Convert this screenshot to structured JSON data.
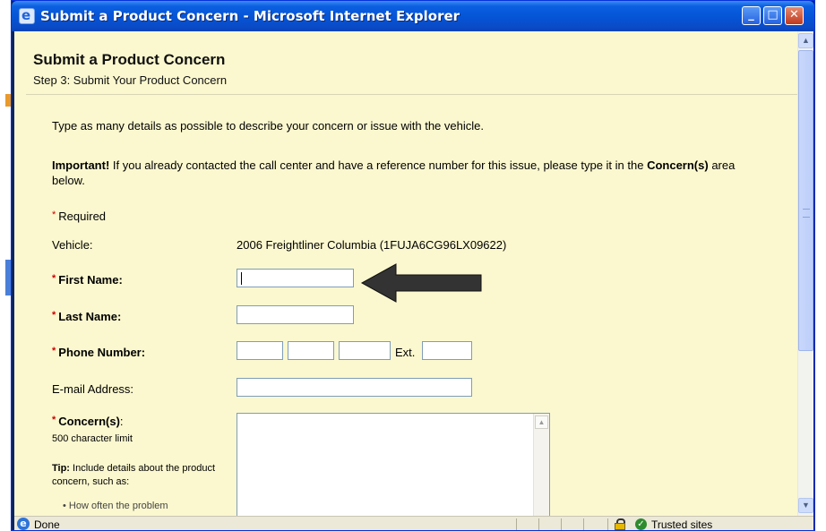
{
  "window": {
    "title": "Submit a Product Concern - Microsoft Internet Explorer",
    "min_glyph": "_",
    "max_glyph": "□",
    "close_glyph": "✕"
  },
  "page": {
    "title": "Submit a Product Concern",
    "subtitle": "Step 3: Submit Your Product Concern",
    "intro": "Type as many details as possible to describe your concern or issue with the vehicle.",
    "important": {
      "lead": "Important!",
      "text1": " If you already contacted the call center and have a reference number for this issue, please type it in the ",
      "emph": "Concern(s)",
      "text2": " area below."
    },
    "required_marker": "*",
    "required_note": "Required"
  },
  "form": {
    "vehicle_label": "Vehicle:",
    "vehicle_value": "2006 Freightliner Columbia (1FUJA6CG96LX09622)",
    "first_name_label": "First Name:",
    "first_name_value": "",
    "last_name_label": "Last Name:",
    "last_name_value": "",
    "phone_label": "Phone Number:",
    "phone_area": "",
    "phone_prefix": "",
    "phone_line": "",
    "ext_label": "Ext.",
    "phone_ext": "",
    "email_label": "E-mail Address:",
    "email_value": "",
    "concern_label": "Concern(s)",
    "concern_colon": ":",
    "concern_note": "500 character limit",
    "concern_value": "",
    "tip_lead": "Tip:",
    "tip_text": " Include details about the product concern, such as:",
    "tip_bullet": "•    How often the problem"
  },
  "statusbar": {
    "status": "Done",
    "zone": "Trusted sites",
    "ie_glyph": "e",
    "check_glyph": "✓"
  },
  "colors": {
    "page_background": "#fbf8cf",
    "title_bar": "#0554d6",
    "required": "#cc0000",
    "annotation_arrow": "#333333"
  }
}
